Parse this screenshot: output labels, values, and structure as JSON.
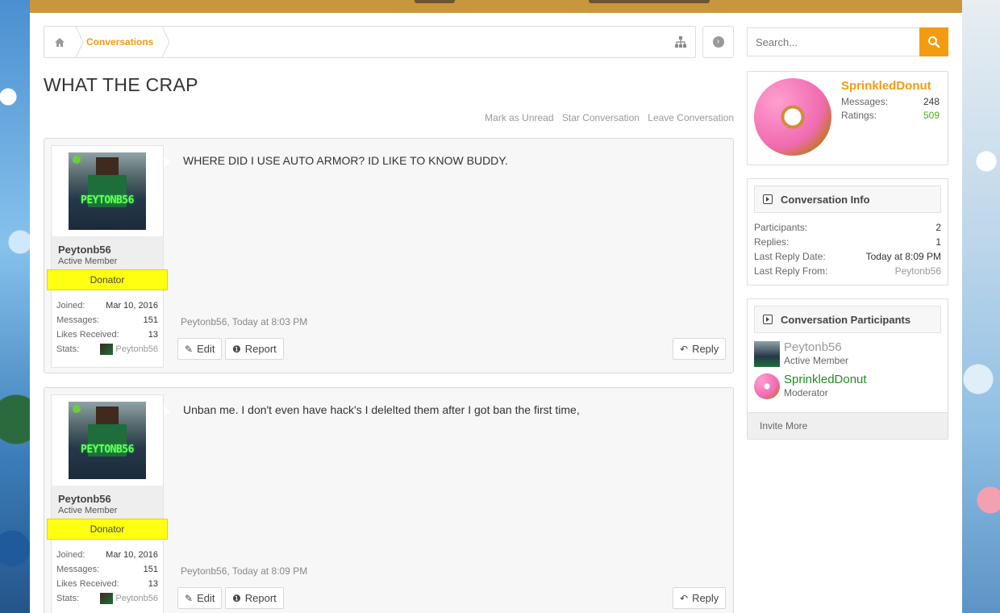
{
  "breadcrumb": {
    "home_icon": "home-icon",
    "current": "Conversations"
  },
  "search": {
    "placeholder": "Search..."
  },
  "conversation": {
    "title": "WHAT THE CRAP",
    "actions": [
      "Mark as Unread",
      "Star Conversation",
      "Leave Conversation"
    ]
  },
  "messages": [
    {
      "username": "Peytonb56",
      "user_title": "Active Member",
      "banner": "Donator",
      "avatar_text": "PEYTONB56",
      "stats": {
        "joined_label": "Joined:",
        "joined": "Mar 10, 2016",
        "messages_label": "Messages:",
        "messages": "151",
        "likes_label": "Likes Received:",
        "likes": "13",
        "stats_label": "Stats:",
        "stats_user": "Peytonb56"
      },
      "text": "WHERE DID I USE AUTO ARMOR? ID LIKE TO KNOW BUDDY.",
      "meta": "Peytonb56, Today at 8:03 PM",
      "edit_label": "Edit",
      "report_label": "Report",
      "reply_label": "Reply"
    },
    {
      "username": "Peytonb56",
      "user_title": "Active Member",
      "banner": "Donator",
      "avatar_text": "PEYTONB56",
      "stats": {
        "joined_label": "Joined:",
        "joined": "Mar 10, 2016",
        "messages_label": "Messages:",
        "messages": "151",
        "likes_label": "Likes Received:",
        "likes": "13",
        "stats_label": "Stats:",
        "stats_user": "Peytonb56"
      },
      "text": "Unban me. I don't even have hack's I delelted them after I got ban the first time,",
      "meta": "Peytonb56, Today at 8:09 PM",
      "edit_label": "Edit",
      "report_label": "Report",
      "reply_label": "Reply"
    }
  ],
  "sidebar": {
    "visitor": {
      "name": "SprinkledDonut",
      "messages_label": "Messages:",
      "messages": "248",
      "ratings_label": "Ratings:",
      "ratings": "509"
    },
    "conversation_info": {
      "title": "Conversation Info",
      "rows": [
        {
          "label": "Participants:",
          "value": "2"
        },
        {
          "label": "Replies:",
          "value": "1"
        },
        {
          "label": "Last Reply Date:",
          "value": "Today at 8:09 PM"
        },
        {
          "label": "Last Reply From:",
          "value": "Peytonb56"
        }
      ]
    },
    "participants": {
      "title": "Conversation Participants",
      "list": [
        {
          "name": "Peytonb56",
          "title": "Active Member"
        },
        {
          "name": "SprinkledDonut",
          "title": "Moderator"
        }
      ],
      "invite_label": "Invite More"
    }
  },
  "colors": {
    "accent": "#f39c12",
    "donator": "#ffff12",
    "rating_green": "#4caf1a",
    "moderator_green": "#228b22"
  }
}
